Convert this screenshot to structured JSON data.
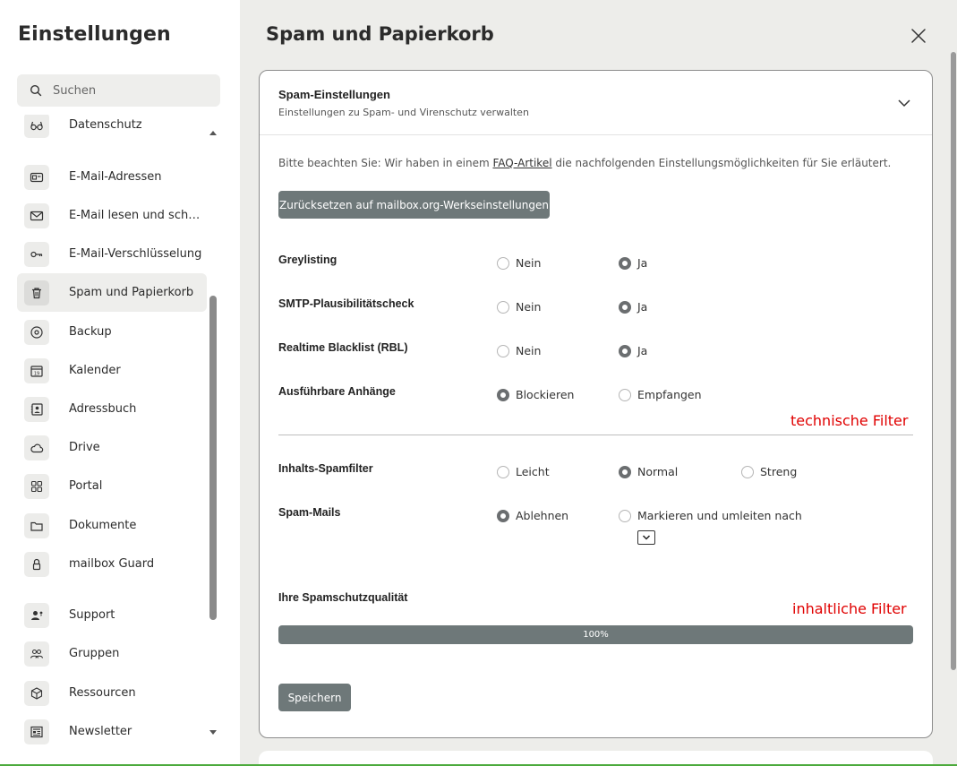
{
  "sidebar": {
    "title": "Einstellungen",
    "search_placeholder": "Suchen",
    "items": [
      {
        "label": "Datenschutz",
        "icon": "glasses-icon"
      },
      {
        "label": "E-Mail-Adressen",
        "icon": "id-card-icon"
      },
      {
        "label": "E-Mail lesen und schreiben",
        "icon": "envelope-icon"
      },
      {
        "label": "E-Mail-Verschlüsselung",
        "icon": "key-icon"
      },
      {
        "label": "Spam und Papierkorb",
        "icon": "trash-icon",
        "active": true
      },
      {
        "label": "Backup",
        "icon": "disc-icon"
      },
      {
        "label": "Kalender",
        "icon": "calendar-icon"
      },
      {
        "label": "Adressbuch",
        "icon": "address-book-icon"
      },
      {
        "label": "Drive",
        "icon": "cloud-icon"
      },
      {
        "label": "Portal",
        "icon": "grid-icon"
      },
      {
        "label": "Dokumente",
        "icon": "folder-icon"
      },
      {
        "label": "mailbox Guard",
        "icon": "lock-icon"
      },
      {
        "label": "Support",
        "icon": "support-user-icon"
      },
      {
        "label": "Gruppen",
        "icon": "group-icon"
      },
      {
        "label": "Ressourcen",
        "icon": "cube-icon"
      },
      {
        "label": "Newsletter",
        "icon": "newspaper-icon"
      }
    ]
  },
  "main": {
    "title": "Spam und Papierkorb",
    "card": {
      "title": "Spam-Einstellungen",
      "subtitle": "Einstellungen zu Spam- und Virenschutz verwalten",
      "note_before": "Bitte beachten Sie: Wir haben in einem ",
      "note_link": "FAQ-Artikel",
      "note_after": " die nachfolgenden Einstellungsmöglichkeiten für Sie erläutert.",
      "reset_button": "Zurücksetzen auf mailbox.org-Werkseinstellungen",
      "settings": [
        {
          "label": "Greylisting",
          "options": [
            "Nein",
            "Ja"
          ],
          "selected": "Ja"
        },
        {
          "label": "SMTP-Plausibilitätscheck",
          "options": [
            "Nein",
            "Ja"
          ],
          "selected": "Ja"
        },
        {
          "label": "Realtime Blacklist (RBL)",
          "options": [
            "Nein",
            "Ja"
          ],
          "selected": "Ja"
        },
        {
          "label": "Ausführbare Anhänge",
          "options": [
            "Blockieren",
            "Empfangen"
          ],
          "selected": "Blockieren"
        },
        {
          "label": "Inhalts-Spamfilter",
          "options": [
            "Leicht",
            "Normal",
            "Streng"
          ],
          "selected": "Normal"
        },
        {
          "label": "Spam-Mails",
          "options": [
            "Ablehnen",
            "Markieren und umleiten nach"
          ],
          "selected": "Ablehnen"
        }
      ],
      "annotation_technical": "technische Filter",
      "annotation_content": "inhaltliche Filter",
      "quality_label": "Ihre Spamschutzqualität",
      "quality_value": 100,
      "quality_text": "100%",
      "save_button": "Speichern"
    }
  },
  "colors": {
    "button": "#6e7879",
    "annotation": "#e00000",
    "main_bg": "#ededea",
    "active_item_bg": "#eeeeec"
  }
}
